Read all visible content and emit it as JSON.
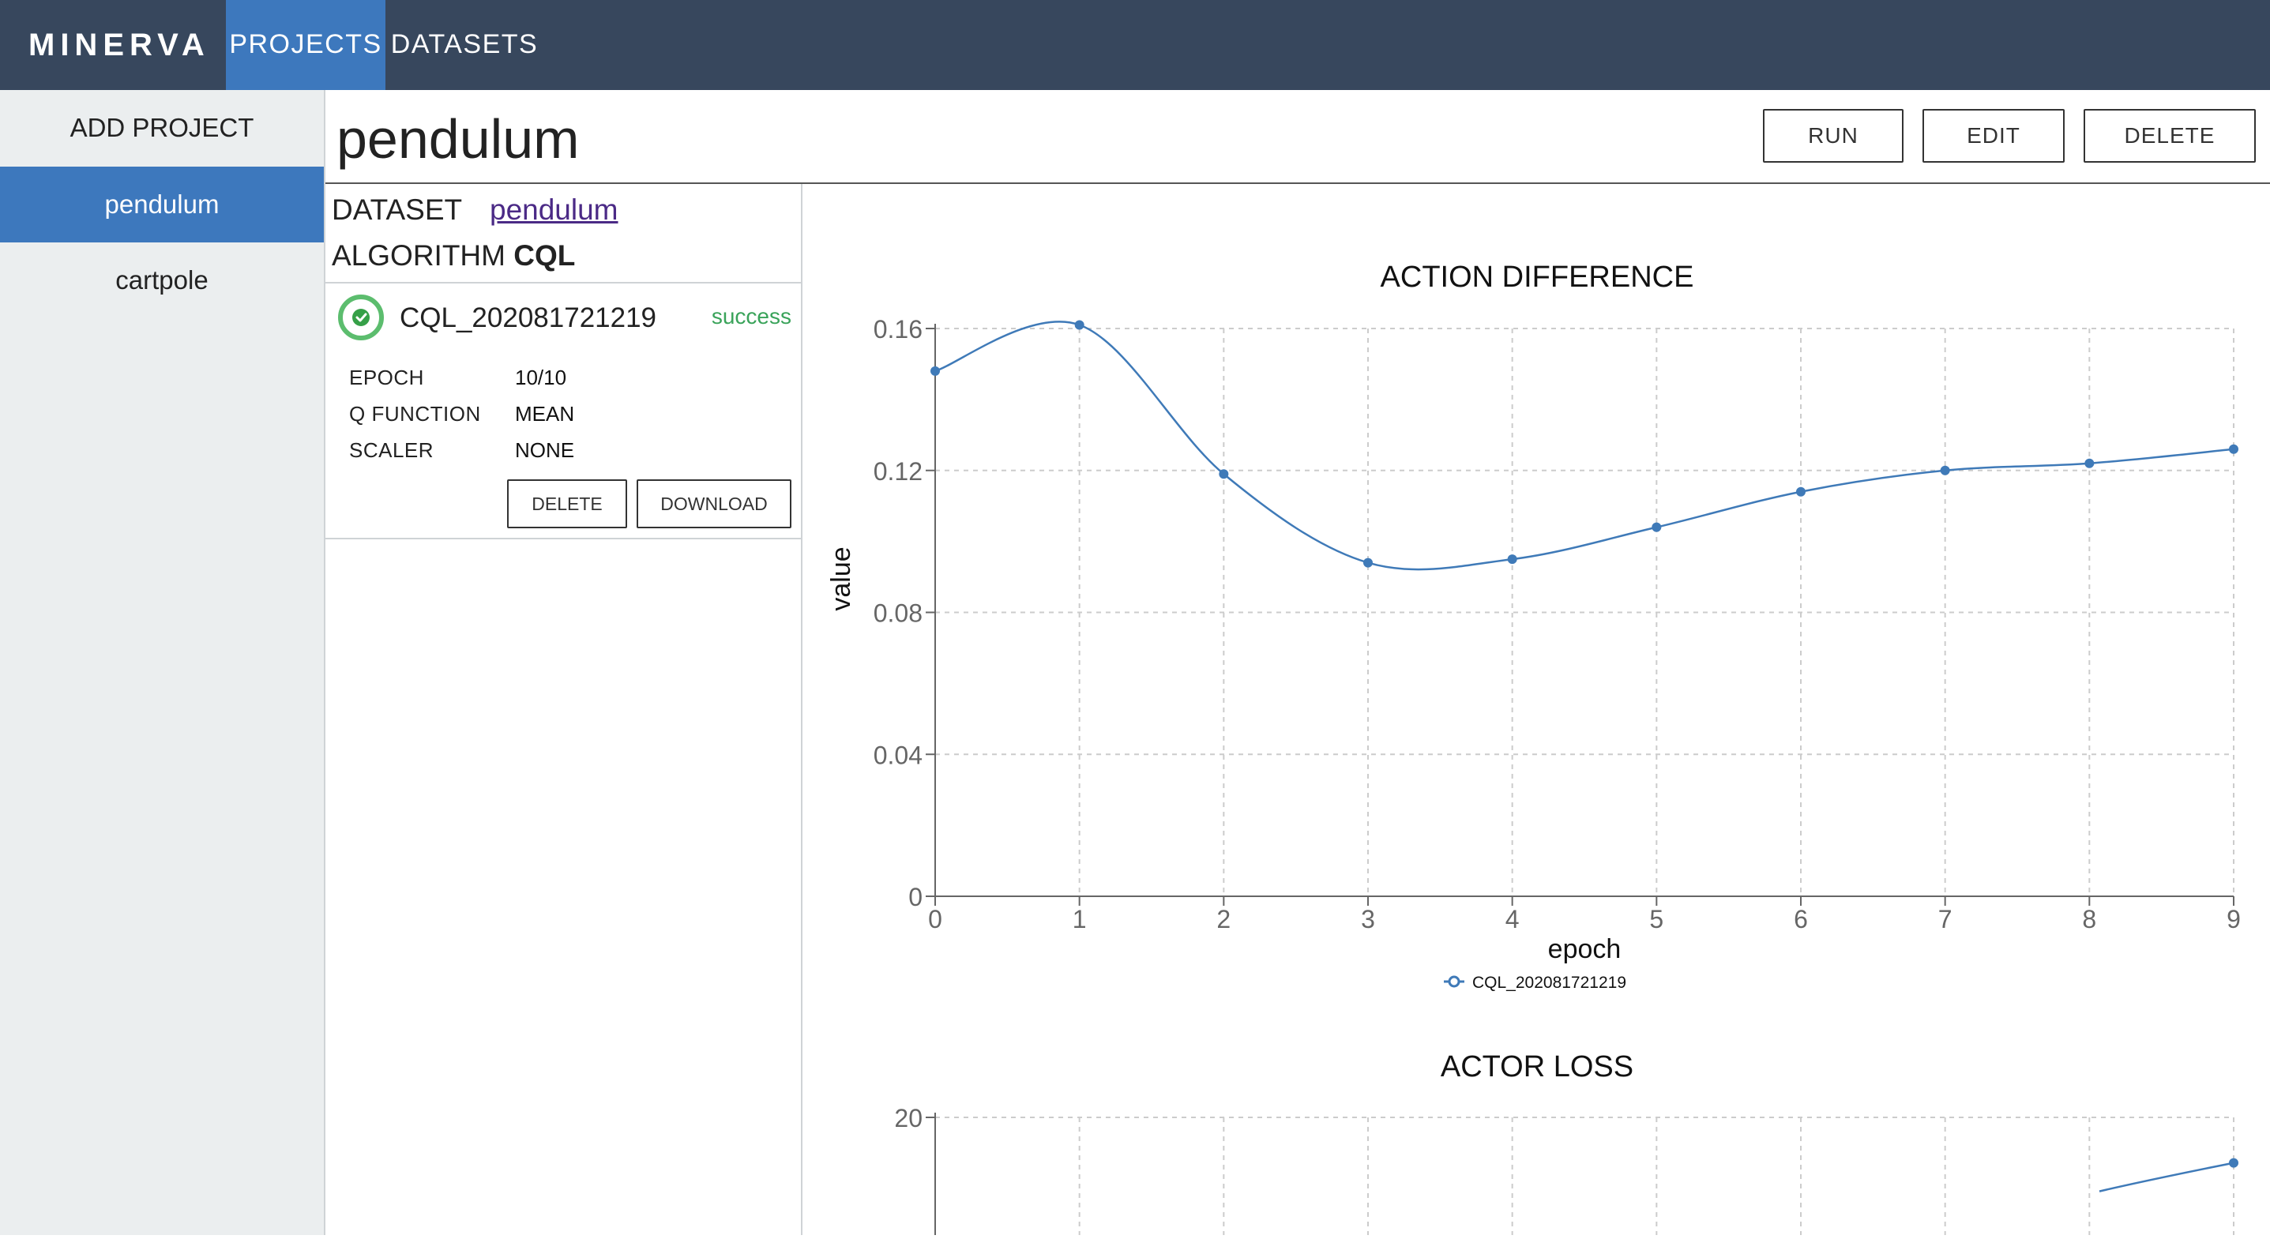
{
  "app": {
    "logo": "MINERVA",
    "nav": [
      {
        "label": "PROJECTS"
      },
      {
        "label": "DATASETS"
      }
    ]
  },
  "sidebar": {
    "add_label": "ADD PROJECT",
    "projects": [
      "pendulum",
      "cartpole"
    ]
  },
  "header": {
    "title": "pendulum",
    "run_label": "RUN",
    "edit_label": "EDIT",
    "delete_label": "DELETE"
  },
  "info": {
    "dataset_label": "DATASET",
    "dataset_value": "pendulum",
    "algorithm_label": "ALGORITHM",
    "algorithm_value": "CQL"
  },
  "experiment": {
    "name": "CQL_202081721219",
    "status": "success",
    "fields": [
      {
        "key": "EPOCH",
        "value": "10/10"
      },
      {
        "key": "Q FUNCTION",
        "value": "MEAN"
      },
      {
        "key": "SCALER",
        "value": "NONE"
      }
    ],
    "delete_label": "DELETE",
    "download_label": "DOWNLOAD"
  },
  "colors": {
    "topbar": "#37475d",
    "accent": "#3d78bd",
    "line": "#3f7ab8",
    "success": "#3aa35a"
  },
  "chart_data": [
    {
      "type": "line",
      "title": "ACTION DIFFERENCE",
      "xlabel": "epoch",
      "ylabel": "value",
      "x": [
        0,
        1,
        2,
        3,
        4,
        5,
        6,
        7,
        8,
        9
      ],
      "xlim": [
        0,
        9
      ],
      "ylim": [
        0,
        0.16
      ],
      "yticks": [
        0,
        0.04,
        0.08,
        0.12,
        0.16
      ],
      "grid": true,
      "legend": "bottom",
      "series": [
        {
          "name": "CQL_202081721219",
          "values": [
            0.148,
            0.161,
            0.119,
            0.094,
            0.095,
            0.104,
            0.114,
            0.12,
            0.122,
            0.126
          ]
        }
      ]
    },
    {
      "type": "line",
      "title": "ACTOR LOSS",
      "yticks": [
        20
      ],
      "grid": true,
      "series": [
        {
          "values": [
            null,
            null,
            null,
            null,
            null,
            null,
            null,
            null,
            null,
            18.4
          ]
        }
      ]
    }
  ]
}
